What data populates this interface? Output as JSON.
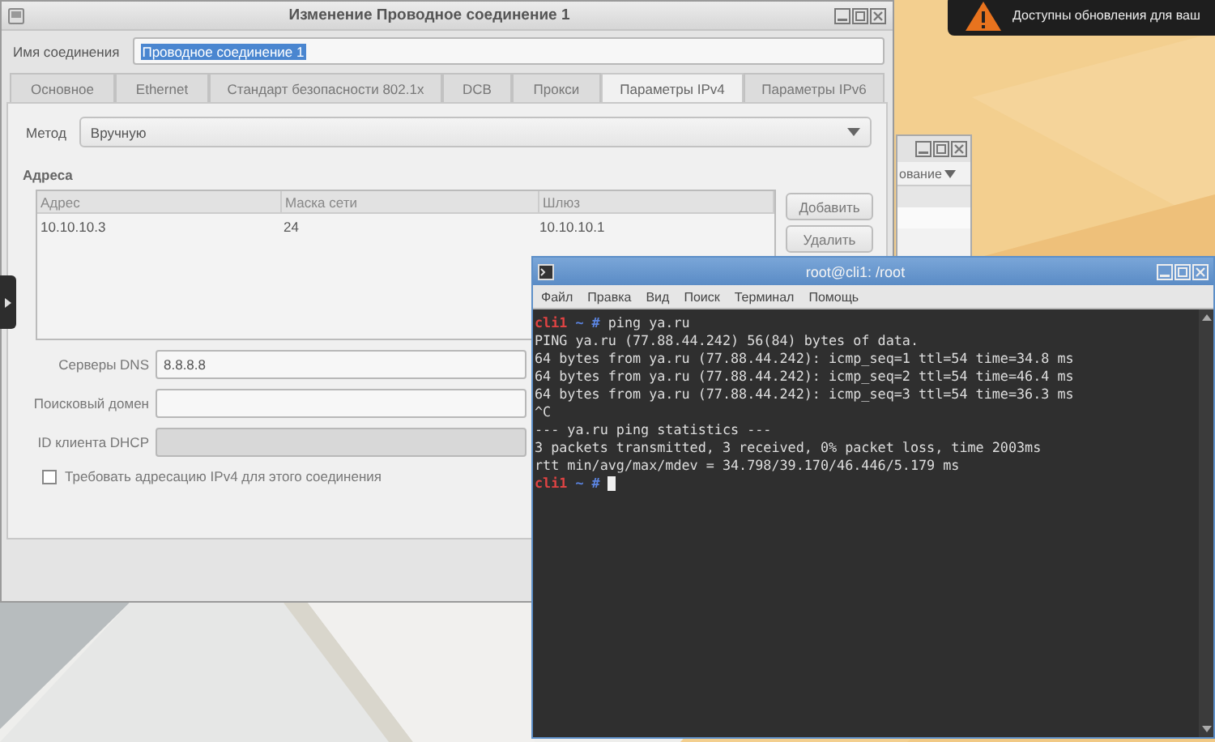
{
  "dialog": {
    "title": "Изменение Проводное соединение 1",
    "name_label": "Имя соединения",
    "name_value": "Проводное соединение 1",
    "tabs": [
      {
        "label": "Основное",
        "selected": false
      },
      {
        "label": "Ethernet",
        "selected": false
      },
      {
        "label": "Стандарт безопасности 802.1x",
        "selected": false
      },
      {
        "label": "DCB",
        "selected": false
      },
      {
        "label": "Прокси",
        "selected": false
      },
      {
        "label": "Параметры IPv4",
        "selected": true
      },
      {
        "label": "Параметры IPv6",
        "selected": false
      }
    ],
    "method_label": "Метод",
    "method_value": "Вручную",
    "addresses_heading": "Адреса",
    "table": {
      "columns": [
        "Адрес",
        "Маска сети",
        "Шлюз"
      ],
      "rows": [
        [
          "10.10.10.3",
          "24",
          "10.10.10.1"
        ]
      ]
    },
    "buttons": [
      "Добавить",
      "Удалить"
    ],
    "fields": [
      {
        "label": "Серверы DNS",
        "value": "8.8.8.8",
        "disabled": false
      },
      {
        "label": "Поисковый домен",
        "disabled": false
      },
      {
        "label": "ID клиента DHCP",
        "disabled": true
      }
    ],
    "checkbox": {
      "label": "Требовать адресацию IPv4 для этого соединения",
      "checked": false
    }
  },
  "back_window": {
    "column_header": "ование"
  },
  "terminal": {
    "title": "root@cli1: /root",
    "menu": [
      "Файл",
      "Правка",
      "Вид",
      "Поиск",
      "Терминал",
      "Помощь"
    ],
    "lines": [
      {
        "kind": "prompt",
        "host": "cli1",
        "path": "~",
        "symbol": "#",
        "command": "ping ya.ru"
      },
      {
        "kind": "output",
        "text": "PING ya.ru (77.88.44.242) 56(84) bytes of data."
      },
      {
        "kind": "output",
        "text": "64 bytes from ya.ru (77.88.44.242): icmp_seq=1 ttl=54 time=34.8 ms"
      },
      {
        "kind": "output",
        "text": "64 bytes from ya.ru (77.88.44.242): icmp_seq=2 ttl=54 time=46.4 ms"
      },
      {
        "kind": "output",
        "text": "64 bytes from ya.ru (77.88.44.242): icmp_seq=3 ttl=54 time=36.3 ms"
      },
      {
        "kind": "output",
        "text": "^C"
      },
      {
        "kind": "output",
        "text": "--- ya.ru ping statistics ---"
      },
      {
        "kind": "output",
        "text": "3 packets transmitted, 3 received, 0% packet loss, time 2003ms"
      },
      {
        "kind": "output",
        "text": "rtt min/avg/max/mdev = 34.798/39.170/46.446/5.179 ms"
      },
      {
        "kind": "prompt",
        "host": "cli1",
        "path": "~",
        "symbol": "#",
        "cursor": true
      }
    ]
  },
  "notification": {
    "text": "Доступны обновления для ваш"
  }
}
